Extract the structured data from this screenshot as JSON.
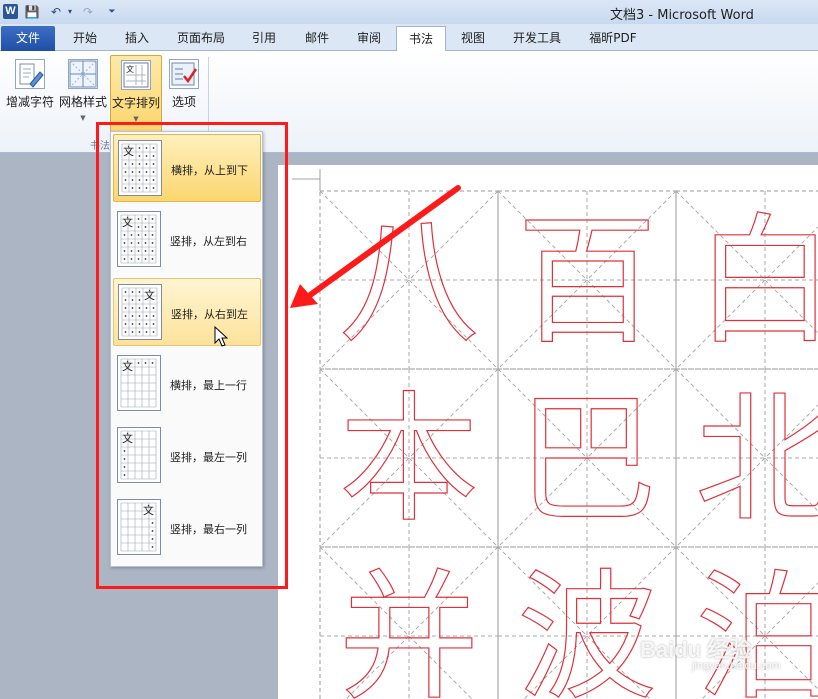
{
  "window": {
    "title": "文档3 - Microsoft Word",
    "logo": "W"
  },
  "quick_access": {
    "save_icon": "floppy-disk-icon",
    "undo_icon": "undo-icon",
    "redo_icon": "redo-icon",
    "customize_icon": "dropdown-arrow-icon"
  },
  "tabs": [
    {
      "label": "文件"
    },
    {
      "label": "开始"
    },
    {
      "label": "插入"
    },
    {
      "label": "页面布局"
    },
    {
      "label": "引用"
    },
    {
      "label": "邮件"
    },
    {
      "label": "审阅"
    },
    {
      "label": "书法"
    },
    {
      "label": "视图"
    },
    {
      "label": "开发工具"
    },
    {
      "label": "福昕PDF"
    }
  ],
  "ribbon": {
    "buttons": [
      {
        "label": "增减字符"
      },
      {
        "label": "网格样式"
      },
      {
        "label": "文字排列"
      },
      {
        "label": "选项"
      }
    ],
    "group_label": "书法"
  },
  "menu": {
    "items": [
      {
        "label": "横排，从上到下"
      },
      {
        "label": "竖排，从左到右"
      },
      {
        "label": "竖排，从右到左"
      },
      {
        "label": "横排，最上一行"
      },
      {
        "label": "竖排，最左一列"
      },
      {
        "label": "竖排，最右一列"
      }
    ],
    "thumb_glyph": "文"
  },
  "document": {
    "characters": [
      "八",
      "百",
      "白",
      "本",
      "巴",
      "北",
      "并",
      "波",
      "泊"
    ]
  },
  "watermark": {
    "main": "Baidu 经验",
    "sub": "jingyan.baidu.com"
  },
  "colors": {
    "annotation": "#ff1a1a",
    "char_outline": "#e0303a",
    "selected": "#fcd66f"
  }
}
